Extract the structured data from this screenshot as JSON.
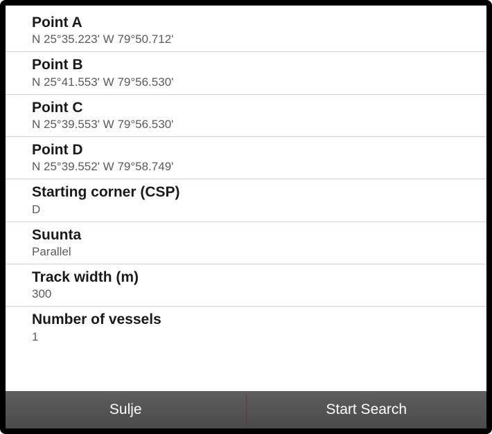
{
  "rows": [
    {
      "title": "Point A",
      "value": "N  25°35.223' W  79°50.712'"
    },
    {
      "title": "Point B",
      "value": "N  25°41.553' W  79°56.530'"
    },
    {
      "title": "Point C",
      "value": "N  25°39.553' W  79°56.530'"
    },
    {
      "title": "Point D",
      "value": "N  25°39.552' W  79°58.749'"
    },
    {
      "title": "Starting corner (CSP)",
      "value": "D"
    },
    {
      "title": "Suunta",
      "value": "Parallel"
    },
    {
      "title": "Track width (m)",
      "value": "300"
    },
    {
      "title": "Number of vessels",
      "value": "1"
    }
  ],
  "buttons": {
    "close": "Sulje",
    "start": "Start Search"
  }
}
